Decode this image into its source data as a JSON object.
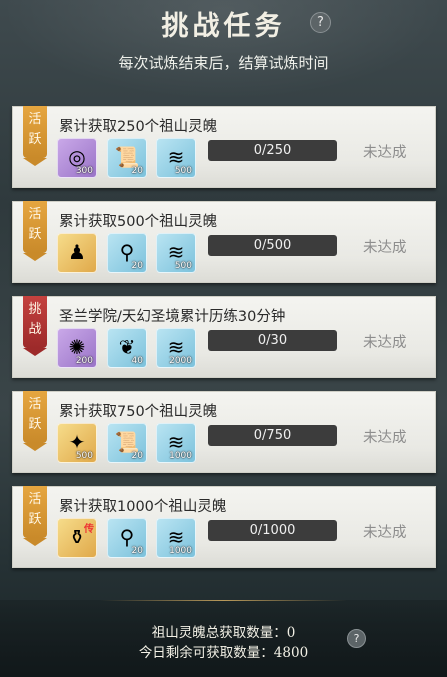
{
  "header": {
    "title": "挑战任务",
    "subtitle": "每次试炼结束后，结算试炼时间",
    "help_icon": "question-circle"
  },
  "colors": {
    "tag_active": "#d9972f",
    "tag_challenge": "#b3383a",
    "progress_bg": "#3c3c3c",
    "status_text": "#8d8d8d"
  },
  "tasks": [
    {
      "tag": "活跃",
      "tag_type": "active",
      "title": "累计获取250个祖山灵魄",
      "rewards": [
        {
          "icon": "swirl-orb",
          "rarity": "purple",
          "count": "300"
        },
        {
          "icon": "scroll",
          "rarity": "blue",
          "count": "20"
        },
        {
          "icon": "cloth-bundle",
          "rarity": "blue",
          "count": "500"
        }
      ],
      "progress": {
        "current": 0,
        "total": 250,
        "label": "0/250"
      },
      "status": "未达成"
    },
    {
      "tag": "活跃",
      "tag_type": "active",
      "title": "累计获取500个祖山灵魄",
      "rewards": [
        {
          "icon": "character-figure",
          "rarity": "gold",
          "count": ""
        },
        {
          "icon": "fairy-figure",
          "rarity": "blue",
          "count": "20"
        },
        {
          "icon": "cloth-bundle",
          "rarity": "blue",
          "count": "500"
        }
      ],
      "progress": {
        "current": 0,
        "total": 500,
        "label": "0/500"
      },
      "status": "未达成"
    },
    {
      "tag": "挑战",
      "tag_type": "challenge",
      "title": "圣兰学院/天幻圣境累计历练30分钟",
      "rewards": [
        {
          "icon": "blue-spirit",
          "rarity": "purple",
          "count": "200"
        },
        {
          "icon": "fish-charm",
          "rarity": "blue",
          "count": "40"
        },
        {
          "icon": "cloth-bundle",
          "rarity": "blue",
          "count": "2000"
        }
      ],
      "progress": {
        "current": 0,
        "total": 30,
        "label": "0/30"
      },
      "status": "未达成"
    },
    {
      "tag": "活跃",
      "tag_type": "active",
      "title": "累计获取750个祖山灵魄",
      "rewards": [
        {
          "icon": "phoenix-feather",
          "rarity": "gold",
          "count": "500"
        },
        {
          "icon": "scroll",
          "rarity": "blue",
          "count": "20"
        },
        {
          "icon": "cloth-bundle",
          "rarity": "blue",
          "count": "1000"
        }
      ],
      "progress": {
        "current": 0,
        "total": 750,
        "label": "0/750"
      },
      "status": "未达成"
    },
    {
      "tag": "活跃",
      "tag_type": "active",
      "title": "累计获取1000个祖山灵魄",
      "rewards": [
        {
          "icon": "bronze-cauldron",
          "rarity": "gold",
          "count": "",
          "badge": "传"
        },
        {
          "icon": "fairy-figure",
          "rarity": "blue",
          "count": "20"
        },
        {
          "icon": "cloth-bundle",
          "rarity": "blue",
          "count": "1000"
        }
      ],
      "progress": {
        "current": 0,
        "total": 1000,
        "label": "0/1000"
      },
      "status": "未达成"
    }
  ],
  "footer": {
    "total_label": "祖山灵魄总获取数量：0",
    "remaining_label": "今日剩余可获取数量：4800"
  }
}
